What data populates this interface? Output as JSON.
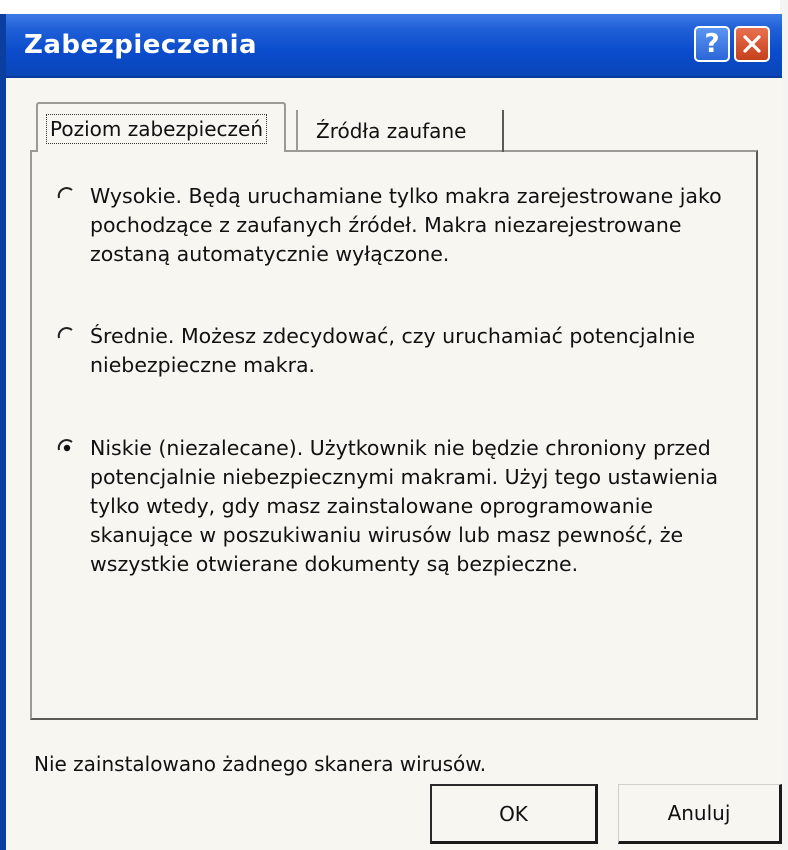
{
  "window": {
    "title": "Zabezpieczenia"
  },
  "titlebar_buttons": {
    "help_symbol": "?",
    "close_icon": "close-x-icon"
  },
  "tabs": [
    {
      "label": "Poziom zabezpieczeń",
      "active": true
    },
    {
      "label": "Źródła zaufane",
      "active": false
    }
  ],
  "security_levels": [
    {
      "label": "Wysokie. Będą uruchamiane tylko makra zarejestrowane jako pochodzące z zaufanych źródeł. Makra niezarejestrowane zostaną automatycznie wyłączone.",
      "selected": false
    },
    {
      "label": "Średnie. Możesz zdecydować, czy uruchamiać potencjalnie niebezpieczne makra.",
      "selected": false
    },
    {
      "label": "Niskie (niezalecane). Użytkownik nie będzie chroniony przed potencjalnie niebezpiecznymi makrami. Użyj tego ustawienia tylko wtedy, gdy masz zainstalowane oprogramowanie skanujące w poszukiwaniu wirusów lub masz pewność, że wszystkie otwierane dokumenty są bezpieczne.",
      "selected": true
    }
  ],
  "status": {
    "text": "Nie zainstalowano żadnego skanera wirusów."
  },
  "buttons": {
    "ok_label": "OK",
    "cancel_label": "Anuluj"
  },
  "colors": {
    "titlebar": "#0b4ccd",
    "close_button": "#c5401c",
    "dialog_background": "#f7f6f1"
  }
}
